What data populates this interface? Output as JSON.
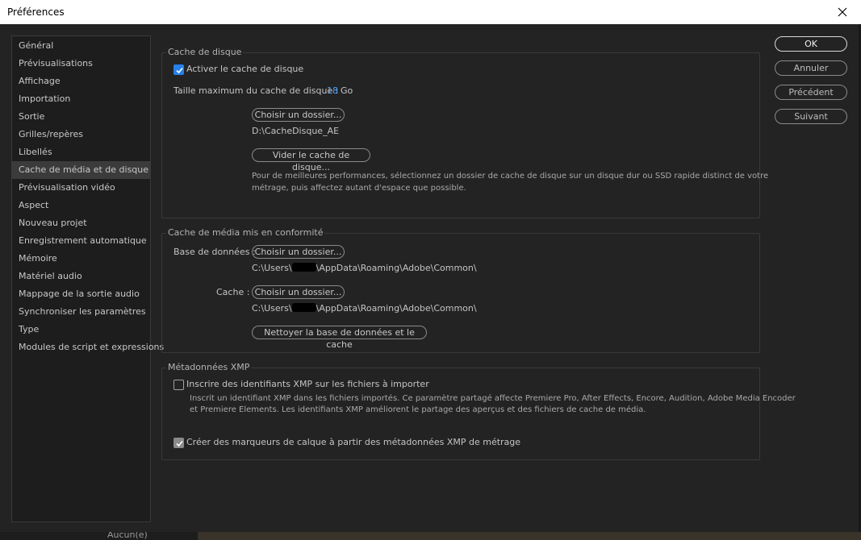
{
  "window": {
    "title": "Préférences"
  },
  "sidebar": {
    "items": [
      {
        "label": "Général"
      },
      {
        "label": "Prévisualisations"
      },
      {
        "label": "Affichage"
      },
      {
        "label": "Importation"
      },
      {
        "label": "Sortie"
      },
      {
        "label": "Grilles/repères"
      },
      {
        "label": "Libellés"
      },
      {
        "label": "Cache de média et de disque",
        "selected": true
      },
      {
        "label": "Prévisualisation vidéo"
      },
      {
        "label": "Aspect"
      },
      {
        "label": "Nouveau projet"
      },
      {
        "label": "Enregistrement automatique"
      },
      {
        "label": "Mémoire"
      },
      {
        "label": "Matériel audio"
      },
      {
        "label": "Mappage de la sortie audio"
      },
      {
        "label": "Synchroniser les paramètres"
      },
      {
        "label": "Type"
      },
      {
        "label": "Modules de script et expressions"
      }
    ]
  },
  "disk_cache": {
    "title": "Cache de disque",
    "enable_label": "Activer le cache de disque",
    "enable_checked": true,
    "max_size_label": "Taille maximum du cache de disque :",
    "max_size_value": "18",
    "max_size_unit": "Go",
    "choose_folder": "Choisir un dossier...",
    "folder_path": "D:\\CacheDisque_AE",
    "empty_cache": "Vider le cache de disque...",
    "hint_line1": "Pour de meilleures performances, sélectionnez un dossier de cache de disque sur un disque dur ou SSD rapide distinct de votre",
    "hint_line2": "métrage, puis affectez autant d'espace que possible."
  },
  "media_cache": {
    "title": "Cache de média mis en conformité",
    "db_label": "Base de données :",
    "db_choose": "Choisir un dossier...",
    "db_path_prefix": "C:\\Users\\",
    "db_path_suffix": "\\AppData\\Roaming\\Adobe\\Common\\",
    "cache_label": "Cache :",
    "cache_choose": "Choisir un dossier...",
    "cache_path_prefix": "C:\\Users\\",
    "cache_path_suffix": "\\AppData\\Roaming\\Adobe\\Common\\",
    "clean_button": "Nettoyer la base de données et le cache"
  },
  "xmp": {
    "title": "Métadonnées XMP",
    "write_label": "Inscrire des identifiants XMP sur les fichiers à importer",
    "write_checked": false,
    "desc_line1": "Inscrit un identifiant XMP dans les fichiers importés. Ce paramètre partagé affecte Premiere Pro, After Effects, Encore, Audition, Adobe Media Encoder",
    "desc_line2": "et  Premiere Elements.  Les  identifiants XMP améliorent le partage des aperçus et des fichiers de cache de média.",
    "markers_label": "Créer des marqueurs de calque à partir des métadonnées XMP de métrage",
    "markers_checked": true
  },
  "actions": {
    "ok": "OK",
    "cancel": "Annuler",
    "previous": "Précédent",
    "next": "Suivant"
  },
  "taskbar": {
    "dropdown_value": "Aucun(e)"
  }
}
